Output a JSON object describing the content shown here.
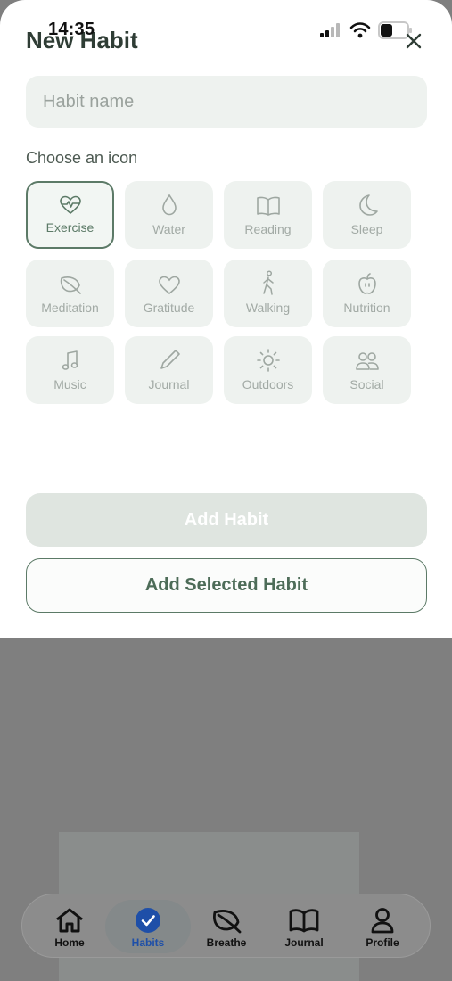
{
  "status_bar": {
    "time": "14:35"
  },
  "sheet": {
    "title": "New Habit",
    "name_input": {
      "placeholder": "Habit name",
      "value": ""
    },
    "icon_section_label": "Choose an icon",
    "selected_icon": "Exercise",
    "icons": [
      {
        "label": "Exercise",
        "icon": "heart-pulse-icon"
      },
      {
        "label": "Water",
        "icon": "water-drop-icon"
      },
      {
        "label": "Reading",
        "icon": "book-icon"
      },
      {
        "label": "Sleep",
        "icon": "moon-icon"
      },
      {
        "label": "Meditation",
        "icon": "leaf-icon"
      },
      {
        "label": "Gratitude",
        "icon": "heart-icon"
      },
      {
        "label": "Walking",
        "icon": "walking-icon"
      },
      {
        "label": "Nutrition",
        "icon": "apple-icon"
      },
      {
        "label": "Music",
        "icon": "music-note-icon"
      },
      {
        "label": "Journal",
        "icon": "pencil-icon"
      },
      {
        "label": "Outdoors",
        "icon": "sun-icon"
      },
      {
        "label": "Social",
        "icon": "people-icon"
      }
    ],
    "add_button": "Add Habit",
    "add_selected_button": "Add Selected Habit"
  },
  "tab_bar": {
    "active": "Habits",
    "tabs": [
      {
        "label": "Home",
        "icon": "home-icon"
      },
      {
        "label": "Habits",
        "icon": "check-circle-icon"
      },
      {
        "label": "Breathe",
        "icon": "leaf-icon"
      },
      {
        "label": "Journal",
        "icon": "open-book-icon"
      },
      {
        "label": "Profile",
        "icon": "person-icon"
      }
    ]
  },
  "colors": {
    "accent": "#5c7a67",
    "tile_bg": "#eef2ef",
    "active_tab": "#1e4fa8"
  }
}
